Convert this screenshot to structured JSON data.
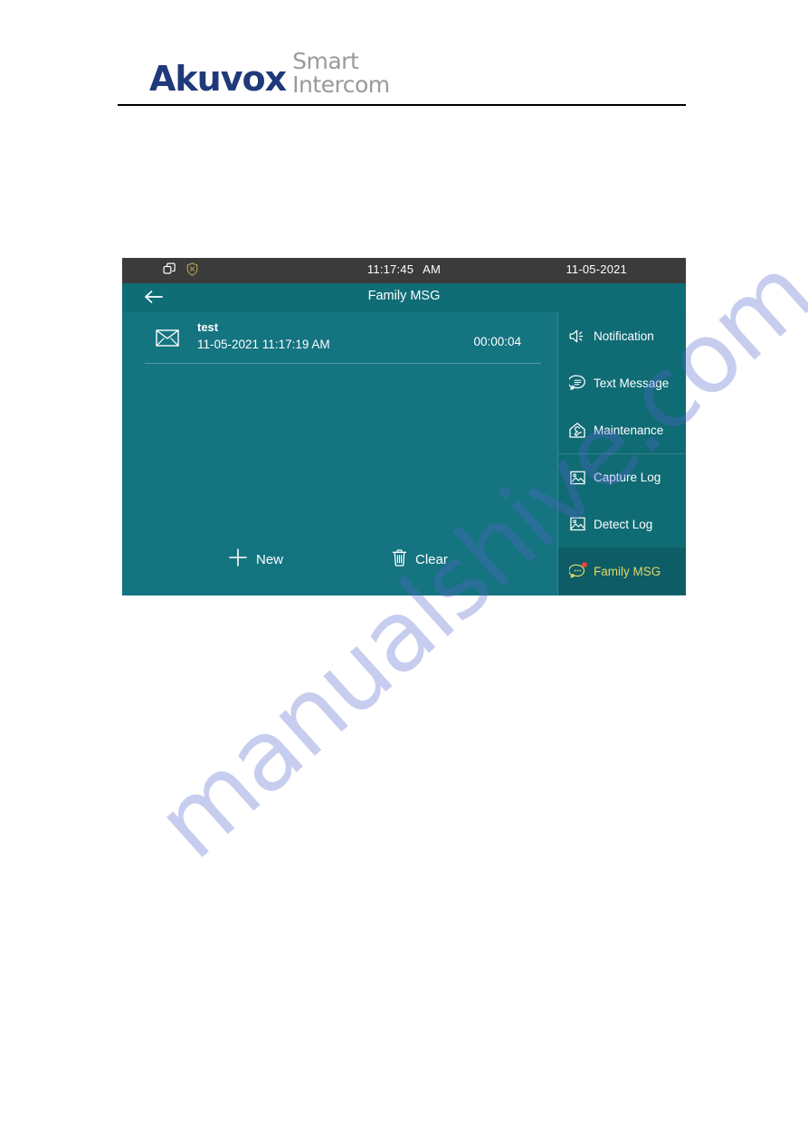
{
  "page": {
    "background": "#ffffff"
  },
  "brand": {
    "name": "Akuvox",
    "tagline_line1": "Smart",
    "tagline_line2": "Intercom",
    "name_color": "#1f3a7a",
    "tagline_color": "#9a9a9a"
  },
  "watermark": {
    "text": "manualshive.com",
    "color": "#5566cc"
  },
  "device": {
    "theme": {
      "screen_bg": "#10717a",
      "statusbar_bg": "#3b3b3b",
      "titlebar_bg": "#0f6d76",
      "panel_bg": "#147480",
      "sidebar_bg": "#0f6b74",
      "active_bg": "#0d5c66",
      "active_text": "#e2d86a",
      "badge": "#e8453c"
    },
    "statusbar": {
      "icons": [
        "windows-stack-icon",
        "shield-icon"
      ],
      "time": "11:17:45",
      "ampm": "AM",
      "date": "11-05-2021"
    },
    "titlebar": {
      "back_icon": "arrow-left-icon",
      "title": "Family MSG"
    },
    "messages": [
      {
        "icon": "envelope-icon",
        "title": "test",
        "datetime": "11-05-2021 11:17:19 AM",
        "duration": "00:00:04"
      }
    ],
    "actions": [
      {
        "icon": "plus-icon",
        "label": "New"
      },
      {
        "icon": "trash-icon",
        "label": "Clear"
      }
    ],
    "sidebar": {
      "items": [
        {
          "icon": "speaker-icon",
          "label": "Notification",
          "active": false,
          "divider_above": false,
          "badge": false
        },
        {
          "icon": "chat-lines-icon",
          "label": "Text Message",
          "active": false,
          "divider_above": false,
          "badge": false
        },
        {
          "icon": "house-wrench-icon",
          "label": "Maintenance",
          "active": false,
          "divider_above": false,
          "badge": false
        },
        {
          "icon": "photo-icon",
          "label": "Capture Log",
          "active": false,
          "divider_above": true,
          "badge": false
        },
        {
          "icon": "photo-icon",
          "label": "Detect Log",
          "active": false,
          "divider_above": false,
          "badge": false
        },
        {
          "icon": "chat-dots-icon",
          "label": "Family MSG",
          "active": true,
          "divider_above": false,
          "badge": true
        }
      ]
    }
  }
}
